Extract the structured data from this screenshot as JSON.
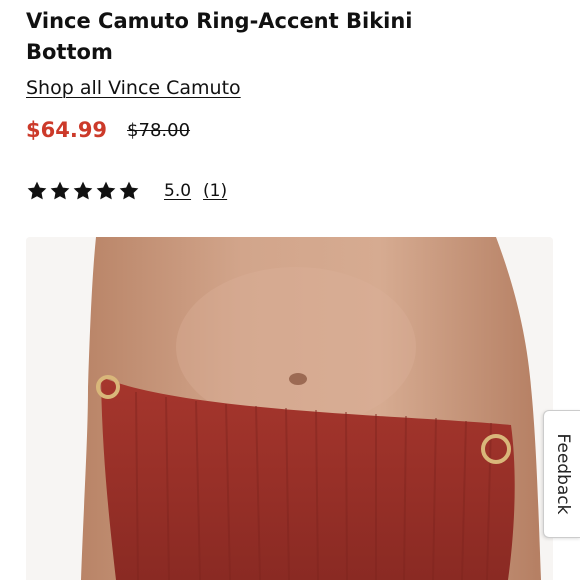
{
  "product": {
    "title": "Vince Camuto Ring-Accent Bikini Bottom",
    "shop_all_label": "Shop all Vince Camuto",
    "sale_price": "$64.99",
    "original_price": "$78.00"
  },
  "rating": {
    "stars": 5,
    "max_stars": 5,
    "value": "5.0",
    "count": "(1)",
    "star_color": "#111111"
  },
  "colors": {
    "sale_price": "#cc3a2a",
    "fabric": "#9b3129",
    "skin": "#c99a80"
  },
  "feedback": {
    "label": "Feedback"
  }
}
